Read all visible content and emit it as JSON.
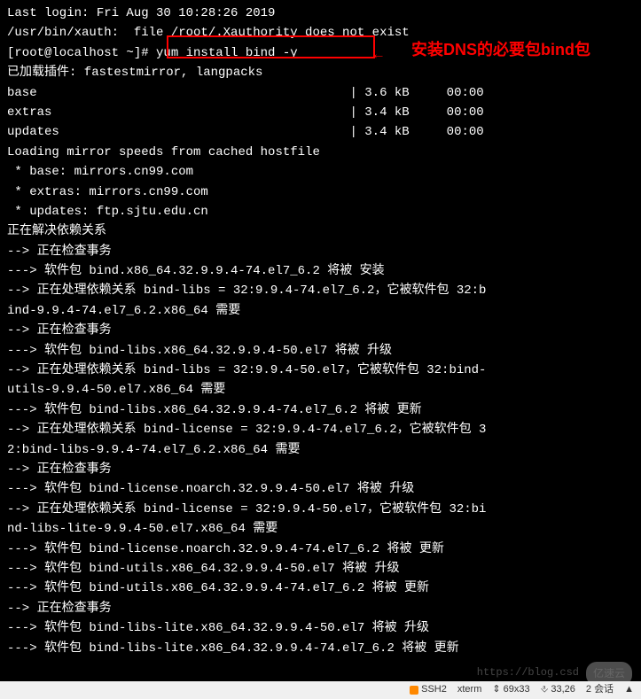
{
  "terminal": {
    "lines": [
      "Last login: Fri Aug 30 10:28:26 2019",
      "/usr/bin/xauth:  file /root/.Xauthority does not exist",
      "[root@localhost ~]# yum install bind -y",
      "已加载插件: fastestmirror, langpacks",
      "base                                          | 3.6 kB     00:00",
      "extras                                        | 3.4 kB     00:00",
      "updates                                       | 3.4 kB     00:00",
      "Loading mirror speeds from cached hostfile",
      " * base: mirrors.cn99.com",
      " * extras: mirrors.cn99.com",
      " * updates: ftp.sjtu.edu.cn",
      "正在解决依赖关系",
      "--> 正在检查事务",
      "---> 软件包 bind.x86_64.32.9.9.4-74.el7_6.2 将被 安装",
      "--> 正在处理依赖关系 bind-libs = 32:9.9.4-74.el7_6.2，它被软件包 32:b",
      "ind-9.9.4-74.el7_6.2.x86_64 需要",
      "--> 正在检查事务",
      "---> 软件包 bind-libs.x86_64.32.9.9.4-50.el7 将被 升级",
      "--> 正在处理依赖关系 bind-libs = 32:9.9.4-50.el7，它被软件包 32:bind-",
      "utils-9.9.4-50.el7.x86_64 需要",
      "---> 软件包 bind-libs.x86_64.32.9.9.4-74.el7_6.2 将被 更新",
      "--> 正在处理依赖关系 bind-license = 32:9.9.4-74.el7_6.2，它被软件包 3",
      "2:bind-libs-9.9.4-74.el7_6.2.x86_64 需要",
      "--> 正在检查事务",
      "---> 软件包 bind-license.noarch.32.9.9.4-50.el7 将被 升级",
      "--> 正在处理依赖关系 bind-license = 32:9.9.4-50.el7，它被软件包 32:bi",
      "nd-libs-lite-9.9.4-50.el7.x86_64 需要",
      "---> 软件包 bind-license.noarch.32.9.9.4-74.el7_6.2 将被 更新",
      "---> 软件包 bind-utils.x86_64.32.9.9.4-50.el7 将被 升级",
      "---> 软件包 bind-utils.x86_64.32.9.9.4-74.el7_6.2 将被 更新",
      "--> 正在检查事务",
      "---> 软件包 bind-libs-lite.x86_64.32.9.9.4-50.el7 将被 升级",
      "---> 软件包 bind-libs-lite.x86_64.32.9.9.4-74.el7_6.2 将被 更新"
    ]
  },
  "annotation": {
    "text": "安装DNS的必要包bind包",
    "arrow": "←"
  },
  "watermark": "https://blog.csd",
  "logo": "亿速云",
  "status_bar": {
    "ssh": "SSH2",
    "term": "xterm",
    "size": "69x33",
    "pos": "33,26",
    "sessions": "2 会话"
  }
}
